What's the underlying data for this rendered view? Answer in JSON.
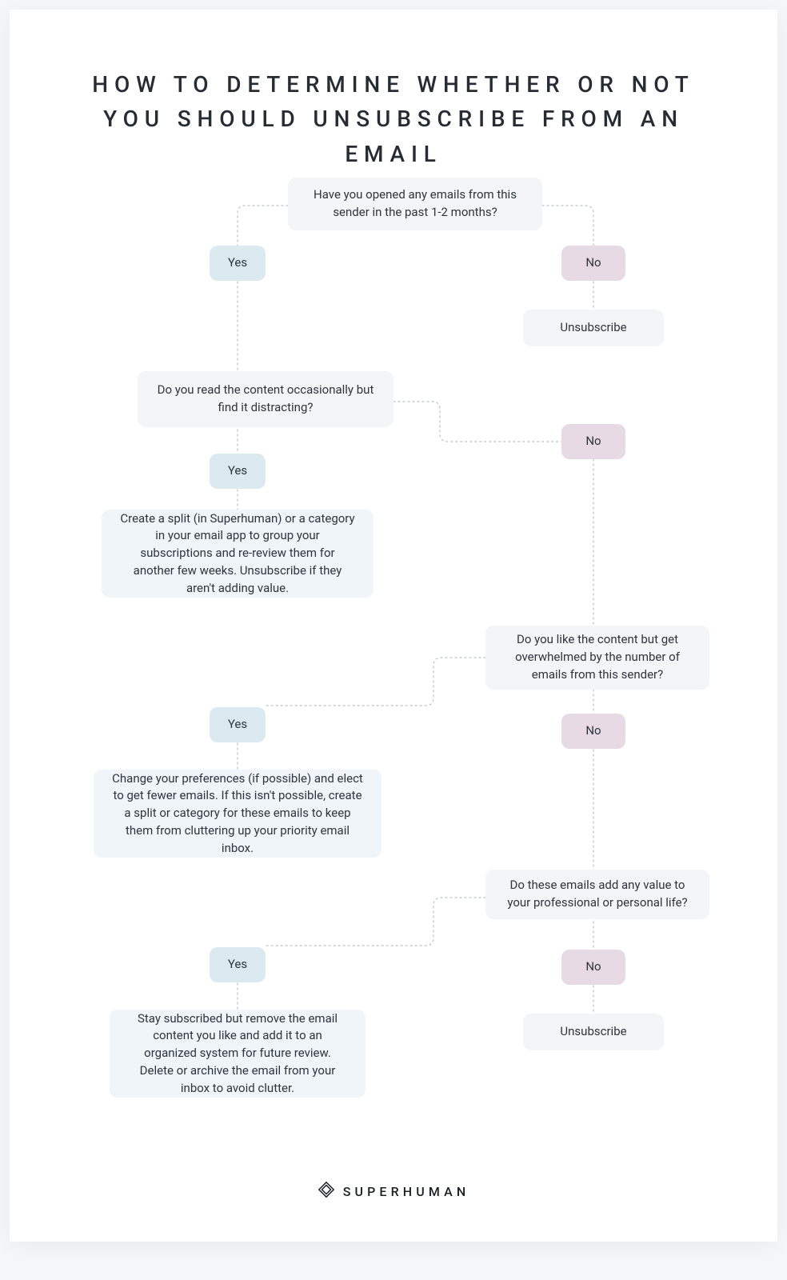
{
  "title": "HOW TO DETERMINE WHETHER OR NOT YOU SHOULD UNSUBSCRIBE FROM AN EMAIL",
  "labels": {
    "yes": "Yes",
    "no": "No",
    "unsubscribe": "Unsubscribe"
  },
  "q1": "Have you opened any emails from this sender in the past 1-2 months?",
  "q2": "Do you read the content occasionally but find it distracting?",
  "q3": "Do you like the content but get overwhelmed by the number of emails from this sender?",
  "q4": "Do these emails add any value to your professional or personal life?",
  "a1": "Create a split (in Superhuman) or a category in your email app to group your subscriptions and re-review them for another few weeks. Unsubscribe if they aren't adding value.",
  "a2": "Change your preferences (if possible) and elect to get fewer emails. If this isn't possible, create a split or category for these emails to keep them from cluttering up your priority email inbox.",
  "a3": "Stay subscribed but remove the email content you like and add it to an organized system for future review. Delete or archive the email from your inbox to avoid clutter.",
  "brand": "SUPERHUMAN"
}
